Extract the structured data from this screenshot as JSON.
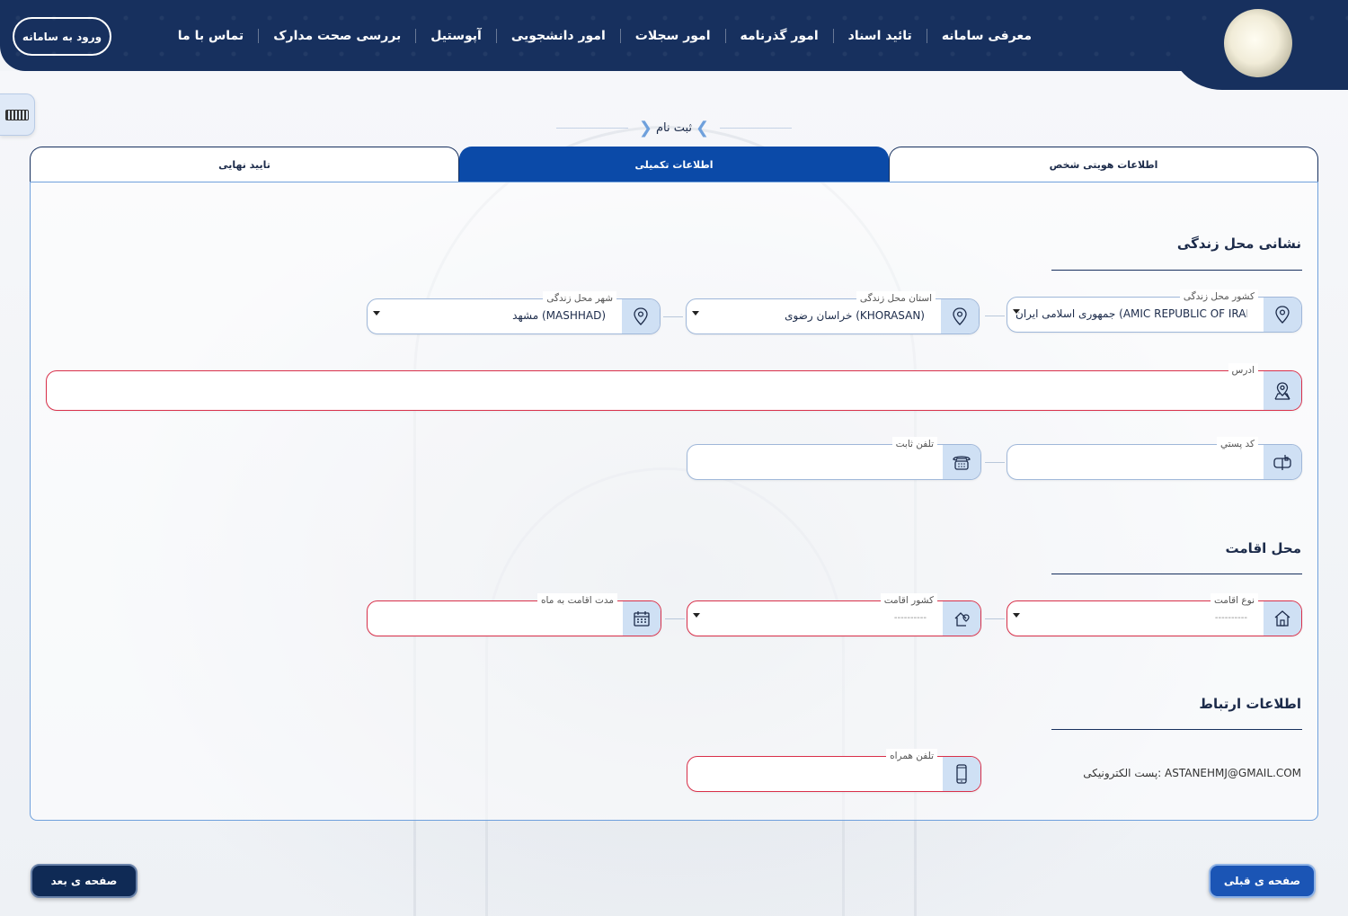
{
  "header": {
    "login_button": "ورود به سامانه",
    "nav": [
      "معرفی سامانه",
      "تائید اسناد",
      "امور گذرنامه",
      "امور سجلات",
      "امور دانشجویی",
      "آپوستیل",
      "بررسی صحت مدارک",
      "تماس با ما"
    ]
  },
  "page_title": "ثبت نام",
  "tabs": [
    {
      "label": "اطلاعات هویتی شخص",
      "active": false
    },
    {
      "label": "اطلاعات تکمیلی",
      "active": true
    },
    {
      "label": "تایید نهایی",
      "active": false
    }
  ],
  "address_section": {
    "title": "نشانی محل زندگی",
    "country": {
      "label": "کشور محل زندگی",
      "value": "جمهوری اسلامی ایران (AMIC REPUBLIC OF IRAN"
    },
    "province": {
      "label": "استان محل زندگی",
      "value": "خراسان رضوی (KHORASAN)"
    },
    "city": {
      "label": "شهر محل زندگی",
      "value": "مشهد (MASHHAD)"
    },
    "address": {
      "label": "ادرس",
      "value": ""
    },
    "postal_code": {
      "label": "کد پستي",
      "value": ""
    },
    "landline": {
      "label": "تلفن ثابت",
      "value": ""
    }
  },
  "residence_section": {
    "title": "محل اقامت",
    "type": {
      "label": "نوع اقامت",
      "placeholder": "----------"
    },
    "country": {
      "label": "کشور اقامت",
      "placeholder": "----------"
    },
    "duration": {
      "label": "مدت اقامت به ماه",
      "value": ""
    }
  },
  "contact_section": {
    "title": "اطلاعات ارتباط",
    "email_line": "پست الکترونیکی: ASTANEHMJ@GMAIL.COM",
    "mobile": {
      "label": "تلفن همراه",
      "value": ""
    }
  },
  "buttons": {
    "previous": "صفحه ی قبلی",
    "next": "صفحه ی بعد"
  },
  "colors": {
    "header": "#17305e",
    "active_tab": "#0b4aa8",
    "error_border": "#d9304a",
    "icon_bg": "#cfe0f4"
  }
}
